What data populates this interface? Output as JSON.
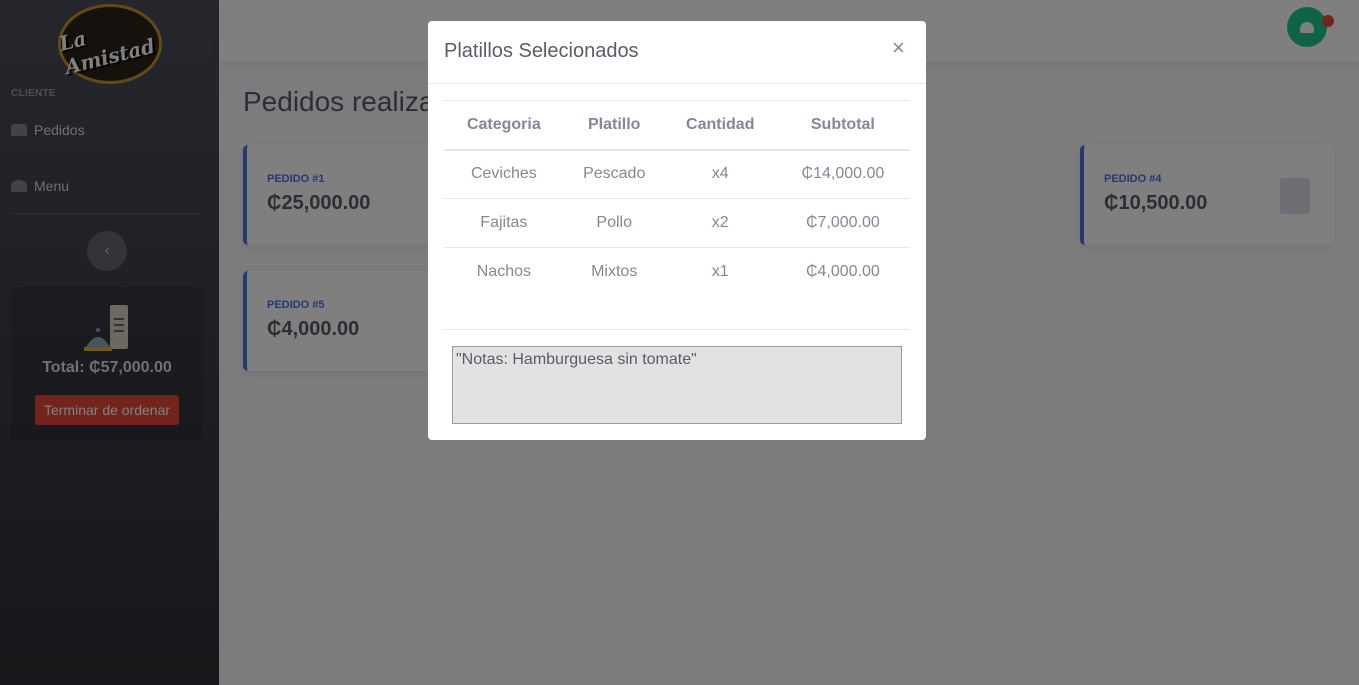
{
  "sidebar": {
    "logo_text": "La Amistad",
    "heading": "CLIENTE",
    "items": [
      {
        "label": "Pedidos",
        "icon": "couch-icon"
      },
      {
        "label": "Menu",
        "icon": "pizza-slice-icon"
      }
    ],
    "cart": {
      "total": "Total: ₵57,000.00",
      "finish_button": "Terminar de ordenar"
    }
  },
  "topbar": {
    "avatar_icon": "hamburger-icon",
    "badge_icon": "bell-icon"
  },
  "main": {
    "title": "Pedidos realizados",
    "orders": [
      {
        "label": "PEDIDO #1",
        "amount": "₵25,000.00"
      },
      {
        "label": "PEDIDO #4",
        "amount": "₵10,500.00"
      },
      {
        "label": "PEDIDO #5",
        "amount": "₵4,000.00"
      }
    ]
  },
  "modal": {
    "title": "Platillos Selecionados",
    "close": "×",
    "columns": [
      "Categoria",
      "Platillo",
      "Cantidad",
      "Subtotal"
    ],
    "rows": [
      [
        "Ceviches",
        "Pescado",
        "x4",
        "₵14,000.00"
      ],
      [
        "Fajitas",
        "Pollo",
        "x2",
        "₵7,000.00"
      ],
      [
        "Nachos",
        "Mixtos",
        "x1",
        "₵4,000.00"
      ]
    ],
    "notes": "\"Notas: Hamburguesa sin tomate\""
  },
  "colors": {
    "primary": "#4e73df",
    "danger": "#e74a3b",
    "success": "#1cc88a"
  }
}
